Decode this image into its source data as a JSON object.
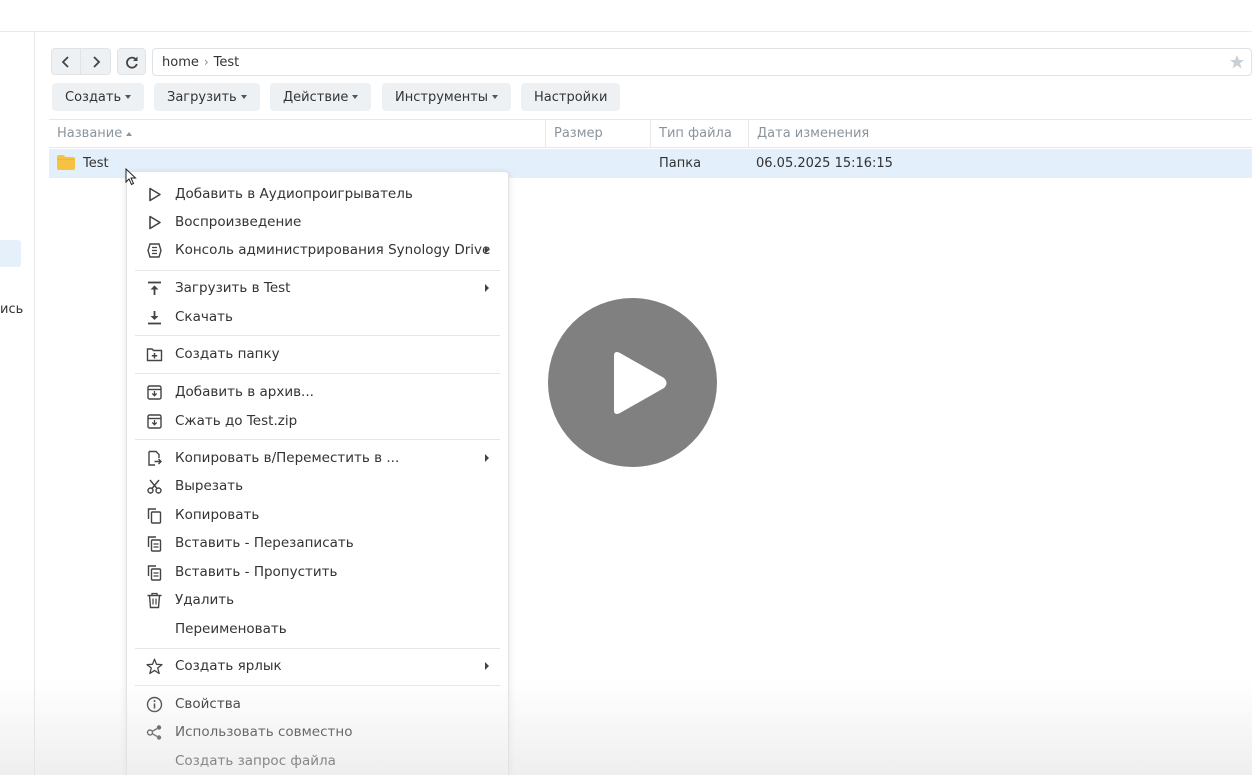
{
  "sidebar": {
    "fragment_label": "ись"
  },
  "nav": {
    "back": "back",
    "forward": "forward",
    "refresh": "refresh"
  },
  "path": {
    "crumbs": [
      "home",
      "Test"
    ],
    "separator": "›"
  },
  "toolbar": {
    "create": "Создать",
    "upload": "Загрузить",
    "action": "Действие",
    "tools": "Инструменты",
    "settings": "Настройки"
  },
  "columns": {
    "name": "Название",
    "size": "Размер",
    "type": "Тип файла",
    "modified": "Дата изменения"
  },
  "rows": [
    {
      "name": "Test",
      "size": "",
      "type": "Папка",
      "modified": "06.05.2025 15:16:15"
    }
  ],
  "context_menu": {
    "items": [
      {
        "label": "Добавить в Аудиопроигрыватель",
        "icon": "play-outline-icon"
      },
      {
        "label": "Воспроизведение",
        "icon": "play-outline-icon"
      },
      {
        "label": "Консоль администрирования Synology Drive",
        "icon": "synology-drive-icon",
        "submenu": true
      },
      {
        "label": "Загрузить в Test",
        "icon": "upload-icon",
        "submenu": true
      },
      {
        "label": "Скачать",
        "icon": "download-icon"
      },
      {
        "label": "Создать папку",
        "icon": "new-folder-icon"
      },
      {
        "label": "Добавить в архив...",
        "icon": "archive-icon"
      },
      {
        "label": "Сжать до Test.zip",
        "icon": "archive-icon"
      },
      {
        "label": "Копировать в/Переместить в ...",
        "icon": "copy-move-icon",
        "submenu": true
      },
      {
        "label": "Вырезать",
        "icon": "scissors-icon"
      },
      {
        "label": "Копировать",
        "icon": "copy-icon"
      },
      {
        "label": "Вставить - Перезаписать",
        "icon": "paste-icon"
      },
      {
        "label": "Вставить - Пропустить",
        "icon": "paste-icon"
      },
      {
        "label": "Удалить",
        "icon": "trash-icon"
      },
      {
        "label": "Переименовать",
        "icon": ""
      },
      {
        "label": "Создать ярлык",
        "icon": "star-outline-icon",
        "submenu": true
      },
      {
        "label": "Свойства",
        "icon": "info-icon"
      },
      {
        "label": "Использовать совместно",
        "icon": "share-icon"
      },
      {
        "label": "Создать запрос файла",
        "icon": ""
      }
    ]
  },
  "overlay": {
    "icon": "play-button-icon"
  },
  "colors": {
    "selected_row": "#e3effb",
    "toolbar_button": "#eef1f3",
    "folder": "#f5c242",
    "play_overlay": "#6e6e6e"
  }
}
